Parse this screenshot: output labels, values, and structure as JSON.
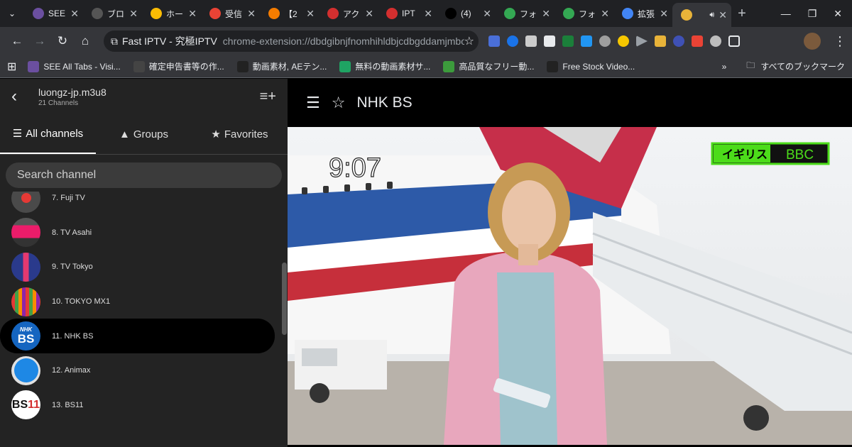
{
  "browser": {
    "tabs": [
      {
        "title": "SEE",
        "icon": "vis-icon",
        "color": "#6b4fa0"
      },
      {
        "title": "ブロ",
        "icon": "blog-icon",
        "color": "#555"
      },
      {
        "title": "ホー",
        "icon": "ads-icon",
        "color": "#fbbc04"
      },
      {
        "title": "受信",
        "icon": "gmail-icon",
        "color": "#ea4335"
      },
      {
        "title": "【2",
        "icon": "blogger-icon",
        "color": "#f57c00"
      },
      {
        "title": "アク",
        "icon": "opera-icon",
        "color": "#d32f2f"
      },
      {
        "title": "IPT",
        "icon": "opera-icon",
        "color": "#d32f2f"
      },
      {
        "title": "(4)",
        "icon": "x-icon",
        "color": "#000"
      },
      {
        "title": "フォ",
        "icon": "photos-icon",
        "color": "#34a853"
      },
      {
        "title": "フォ",
        "icon": "photos-icon",
        "color": "#34a853"
      },
      {
        "title": "拡張",
        "icon": "puzzle-icon",
        "color": "#4285f4"
      },
      {
        "title": "",
        "icon": "iptv-icon",
        "color": "#e8b339",
        "active": true
      }
    ],
    "omnibox": {
      "site_name": "Fast IPTV - 究極IPTV",
      "url": "chrome-extension://dbdgibnjfnomhihldbjcdbgddamjmbo..."
    },
    "bookmarks": [
      {
        "label": "SEE All Tabs - Visi...",
        "icon": "vis-icon",
        "color": "#6b4fa0"
      },
      {
        "label": "確定申告書等の作...",
        "icon": "tax-icon",
        "color": "#444"
      },
      {
        "label": "動画素材, AEテン...",
        "icon": "aftereffects-icon",
        "color": "#222"
      },
      {
        "label": "無料の動画素材サ...",
        "icon": "arrow-icon",
        "color": "#1fa463"
      },
      {
        "label": "高品質なフリー動...",
        "icon": "px-icon",
        "color": "#3c9b3c"
      },
      {
        "label": "Free Stock Video...",
        "icon": "stock-icon",
        "color": "#222"
      }
    ],
    "all_bookmarks_label": "すべてのブックマーク"
  },
  "sidebar": {
    "playlist_name": "luongz-jp.m3u8",
    "channel_count": "21 Channels",
    "tabs": [
      {
        "label": "All channels",
        "active": true
      },
      {
        "label": "Groups",
        "active": false
      },
      {
        "label": "Favorites",
        "active": false
      }
    ],
    "search_placeholder": "Search channel",
    "channels": [
      {
        "name": "7. Fuji TV",
        "logo": "fuji-tv-logo"
      },
      {
        "name": "8. TV Asahi",
        "logo": "tv-asahi-logo"
      },
      {
        "name": "9. TV Tokyo",
        "logo": "tv-tokyo-logo"
      },
      {
        "name": "10. TOKYO MX1",
        "logo": "tokyo-mx-logo"
      },
      {
        "name": "11. NHK BS",
        "logo": "nhk-bs-logo",
        "selected": true
      },
      {
        "name": "12. Animax",
        "logo": "animax-logo"
      },
      {
        "name": "13. BS11",
        "logo": "bs11-logo"
      }
    ]
  },
  "player": {
    "channel_title": "NHK BS",
    "overlay_clock": "9:07",
    "overlay_country": "イギリス",
    "overlay_source": "BBC"
  }
}
